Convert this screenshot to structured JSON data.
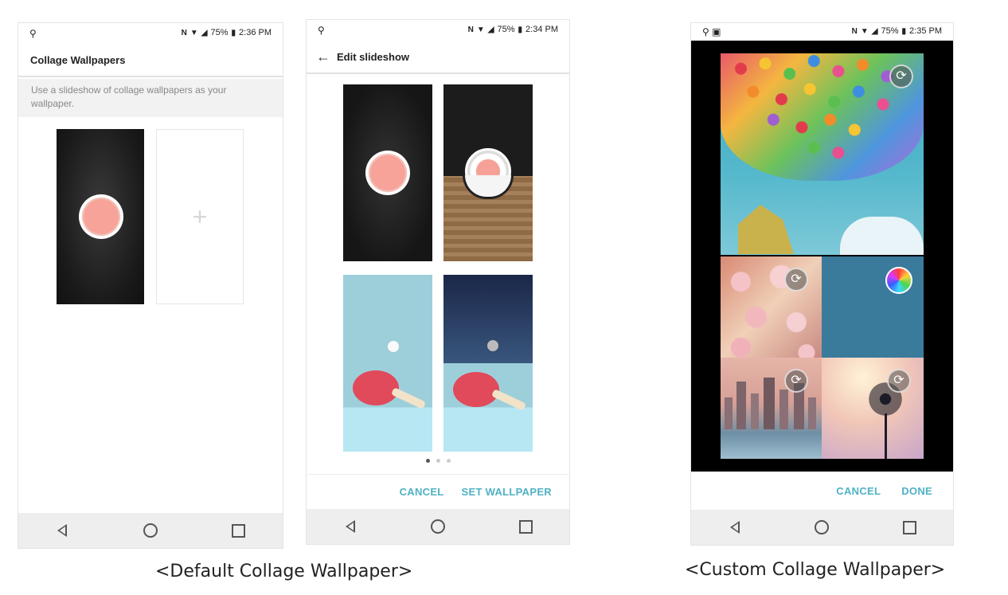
{
  "phone1": {
    "status": {
      "time": "2:36 PM",
      "battery": "75%",
      "left_icon": "usb-icon"
    },
    "appbar_title": "Collage Wallpapers",
    "description": "Use a slideshow of collage wallpapers as your wallpaper.",
    "add_slot_icon": "plus-icon"
  },
  "phone2": {
    "status": {
      "time": "2:34 PM",
      "battery": "75%",
      "left_icon": "usb-icon"
    },
    "appbar_title": "Edit slideshow",
    "cancel_label": "CANCEL",
    "set_label": "SET WALLPAPER",
    "page_indicator": {
      "pages": 3,
      "current": 1
    }
  },
  "phone3": {
    "status": {
      "time": "2:35 PM",
      "battery": "75%",
      "left_icon": "usb-icon"
    },
    "cancel_label": "CANCEL",
    "done_label": "DONE"
  },
  "captions": {
    "default": "<Default Collage Wallpaper>",
    "custom": "<Custom Collage Wallpaper>"
  },
  "colors": {
    "accent": "#4fb2c4",
    "navbar": "#eeeeef"
  }
}
